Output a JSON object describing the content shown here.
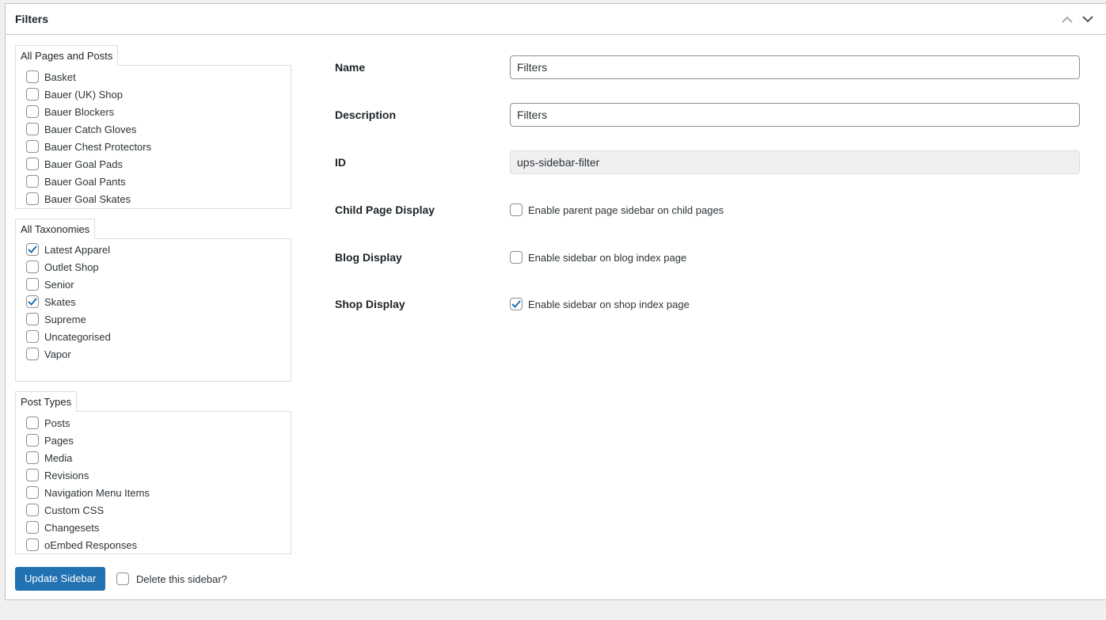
{
  "panel": {
    "title": "Filters"
  },
  "pages_box": {
    "label": "All Pages and Posts",
    "items": [
      {
        "label": "Basket",
        "checked": false
      },
      {
        "label": "Bauer (UK) Shop",
        "checked": false
      },
      {
        "label": "Bauer Blockers",
        "checked": false
      },
      {
        "label": "Bauer Catch Gloves",
        "checked": false
      },
      {
        "label": "Bauer Chest Protectors",
        "checked": false
      },
      {
        "label": "Bauer Goal Pads",
        "checked": false
      },
      {
        "label": "Bauer Goal Pants",
        "checked": false
      },
      {
        "label": "Bauer Goal Skates",
        "checked": false
      }
    ]
  },
  "taxonomies_box": {
    "label": "All Taxonomies",
    "items": [
      {
        "label": "Latest Apparel",
        "checked": true
      },
      {
        "label": "Outlet Shop",
        "checked": false
      },
      {
        "label": "Senior",
        "checked": false
      },
      {
        "label": "Skates",
        "checked": true
      },
      {
        "label": "Supreme",
        "checked": false
      },
      {
        "label": "Uncategorised",
        "checked": false
      },
      {
        "label": "Vapor",
        "checked": false
      }
    ]
  },
  "post_types_box": {
    "label": "Post Types",
    "items": [
      {
        "label": "Posts",
        "checked": false
      },
      {
        "label": "Pages",
        "checked": false
      },
      {
        "label": "Media",
        "checked": false
      },
      {
        "label": "Revisions",
        "checked": false
      },
      {
        "label": "Navigation Menu Items",
        "checked": false
      },
      {
        "label": "Custom CSS",
        "checked": false
      },
      {
        "label": "Changesets",
        "checked": false
      },
      {
        "label": "oEmbed Responses",
        "checked": false
      }
    ]
  },
  "form": {
    "name_label": "Name",
    "name_value": "Filters",
    "description_label": "Description",
    "description_value": "Filters",
    "id_label": "ID",
    "id_value": "ups-sidebar-filter",
    "child_page_label": "Child Page Display",
    "child_page_text": "Enable parent page sidebar on child pages",
    "child_page_checked": false,
    "blog_label": "Blog Display",
    "blog_text": "Enable sidebar on blog index page",
    "blog_checked": false,
    "shop_label": "Shop Display",
    "shop_text": "Enable sidebar on shop index page",
    "shop_checked": true
  },
  "actions": {
    "update_label": "Update Sidebar",
    "delete_label": "Delete this sidebar?",
    "delete_checked": false
  },
  "colors": {
    "accent": "#2271b1",
    "border": "#c3c4c7",
    "background": "#f0f0f1"
  }
}
